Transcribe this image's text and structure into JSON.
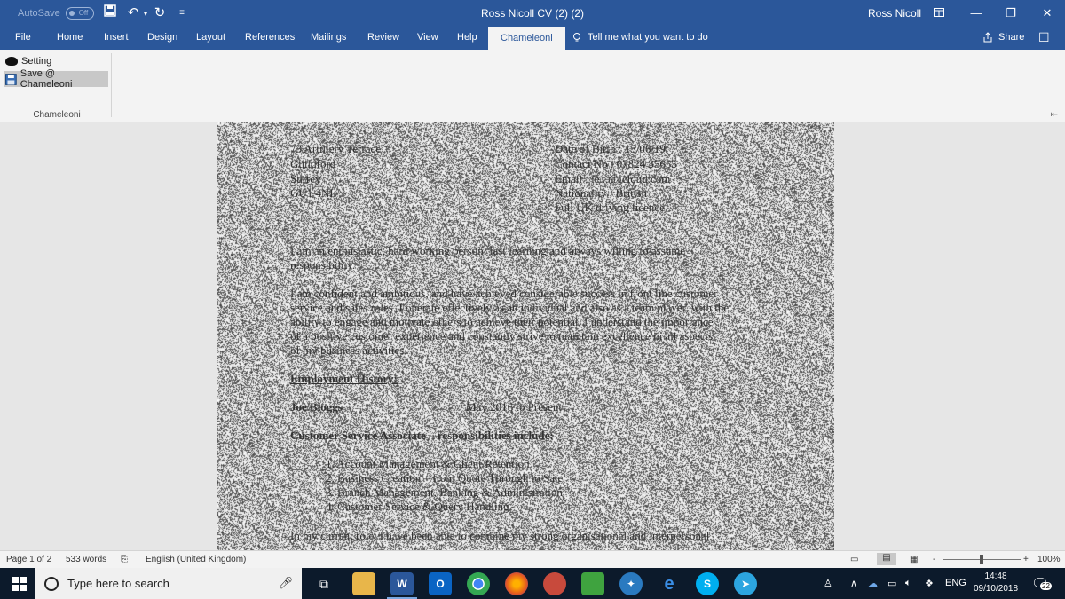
{
  "titlebar": {
    "autosave_label": "AutoSave",
    "autosave_state": "Off",
    "document_title": "Ross Nicoll CV (2) (2)",
    "user_name": "Ross Nicoll"
  },
  "tabs": [
    {
      "label": "File"
    },
    {
      "label": "Home"
    },
    {
      "label": "Insert"
    },
    {
      "label": "Design"
    },
    {
      "label": "Layout"
    },
    {
      "label": "References"
    },
    {
      "label": "Mailings"
    },
    {
      "label": "Review"
    },
    {
      "label": "View"
    },
    {
      "label": "Help"
    },
    {
      "label": "Chameleoni"
    }
  ],
  "tell_me": "Tell me what you want to do",
  "share_label": "Share",
  "ribbon": {
    "setting_label": "Setting",
    "save_label": "Save @ Chameleoni",
    "group_label": "Chameleoni"
  },
  "document": {
    "address": [
      "73 Artillery Terrace",
      "Guildford",
      "Surrey",
      "GU1 4NL"
    ],
    "details": [
      "Date of Birth : 15/06/19",
      "Contact No : 07824 35655",
      "Email : le...@icloud.com",
      "Nationality : British",
      "Full UK driving licence"
    ],
    "intro_1": [
      "I am an enthusiastic, hard working person, fast learning and always willing to assume",
      "responsibility."
    ],
    "intro_2": [
      "I am confident and ambitious, and have achieved considerable success in front line customer",
      "service and sales roles. I operate effectively as an individual and also as a team player, with the",
      "ability to engage and motivate others to achieve their potential. I understand the importance",
      "of a positive customer experience and constantly strive to maintain excellence in all aspects",
      "of my business activities."
    ],
    "employment_heading": "Employment History:",
    "employer": "Joe Bloggs",
    "employment_dates": "May 2016 to Present",
    "role_line": "Customer Service Associate – responsibilities include:",
    "responsibilities": [
      "1.   Account Management & Client Retention",
      "2.   Business Creation – from Quote Through to Sale",
      "3.   Branch Management, Banking & Administration",
      "4.   Customer Service & Query Handling"
    ],
    "closing_line": "In my current role, I have been able to combine my strong organisational and interpersonal"
  },
  "statusbar": {
    "page": "Page 1 of 2",
    "words": "533 words",
    "language": "English (United Kingdom)",
    "zoom": "100%",
    "zoom_minus": "-",
    "zoom_plus": "+"
  },
  "taskbar": {
    "search_placeholder": "Type here to search",
    "language": "ENG",
    "time": "14:48",
    "date": "09/10/2018",
    "notification_count": "22"
  },
  "colors": {
    "word_blue": "#2b579a",
    "ribbon_bg": "#f3f3f3",
    "taskbar_bg": "#0c1a2b"
  }
}
